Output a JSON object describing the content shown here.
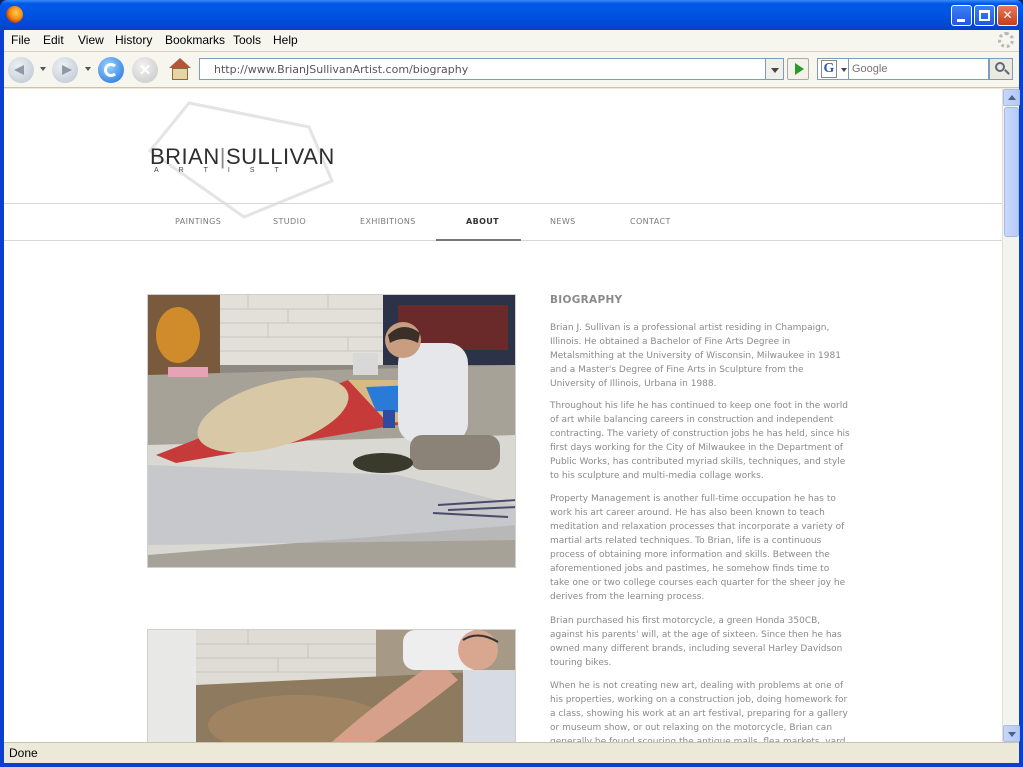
{
  "browser": {
    "menu": [
      "File",
      "Edit",
      "View",
      "History",
      "Bookmarks",
      "Tools",
      "Help"
    ],
    "url": "http://www.BrianJSullivanArtist.com/biography",
    "search_placeholder": "Google",
    "status": "Done"
  },
  "site": {
    "logo": {
      "first": "BRIAN",
      "second": "SULLIVAN",
      "sub": "ARTIST"
    },
    "nav": [
      {
        "label": "PAINTINGS",
        "active": false
      },
      {
        "label": "STUDIO",
        "active": false
      },
      {
        "label": "EXHIBITIONS",
        "active": false
      },
      {
        "label": "ABOUT",
        "active": true
      },
      {
        "label": "NEWS",
        "active": false
      },
      {
        "label": "CONTACT",
        "active": false
      }
    ],
    "bio_title": "BIOGRAPHY",
    "paragraphs": [
      "Brian J. Sullivan is a professional artist residing in Champaign, Illinois. He obtained a Bachelor of Fine Arts Degree in Metalsmithing at the University of Wisconsin, Milwaukee in 1981 and a Master's Degree of Fine Arts in Sculpture from the University of Illinois, Urbana in 1988.",
      "Throughout his life he has continued to keep one foot in the world of art while balancing careers in construction and independent contracting. The variety of construction jobs he has held, since his first days working for the City of Milwaukee in the Department of Public Works, has contributed myriad skills, techniques, and style to his sculpture and multi-media collage works.",
      "Property Management is another full-time occupation he has to work his art career around. He has also been known to teach meditation and relaxation processes that incorporate a variety of martial arts related techniques. To Brian, life is a continuous process of obtaining more information and skills. Between the aforementioned jobs and pastimes, he somehow finds time to take one or two college courses each quarter for the sheer joy he derives from the learning process.",
      "Brian purchased his first motorcycle, a green Honda 350CB, against his parents' will, at the age of sixteen. Since then he has owned many different brands, including several Harley Davidson touring bikes.",
      "When he is not creating new art, dealing with problems at one of his properties, working on a construction job, doing homework for a class, showing his work at an art festival, preparing for a gallery or museum show, or out relaxing on the motorcycle, Brian can generally be found scouring the antique malls, flea markets, yard"
    ]
  }
}
